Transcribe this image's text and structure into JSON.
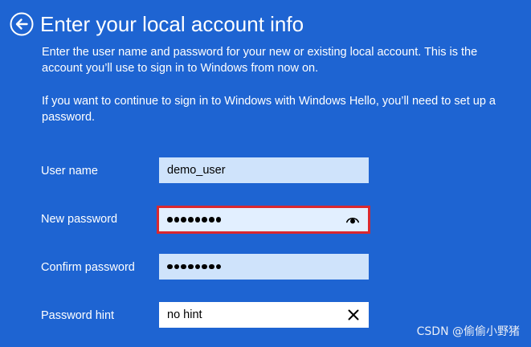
{
  "header": {
    "title": "Enter your local account info",
    "back_icon": "back-arrow-circle-icon"
  },
  "description": {
    "paragraph1": "Enter the user name and password for your new or existing local account. This is the account you’ll use to sign in to Windows from now on.",
    "paragraph2": "If you want to continue to sign in to Windows with Windows Hello, you’ll need to set up a password."
  },
  "form": {
    "user_name": {
      "label": "User name",
      "value": "demo_user"
    },
    "new_password": {
      "label": "New password",
      "masked_length": 8,
      "icon": "reveal-password-eye-icon"
    },
    "confirm_password": {
      "label": "Confirm password",
      "masked_length": 8
    },
    "password_hint": {
      "label": "Password hint",
      "value": "no hint",
      "icon": "clear-x-icon"
    }
  },
  "colors": {
    "background": "#1e64d2",
    "field_background": "#cfe3fb",
    "focus_border": "#d9282f",
    "text": "#ffffff"
  },
  "watermark": "CSDN @偷偷小野猪"
}
